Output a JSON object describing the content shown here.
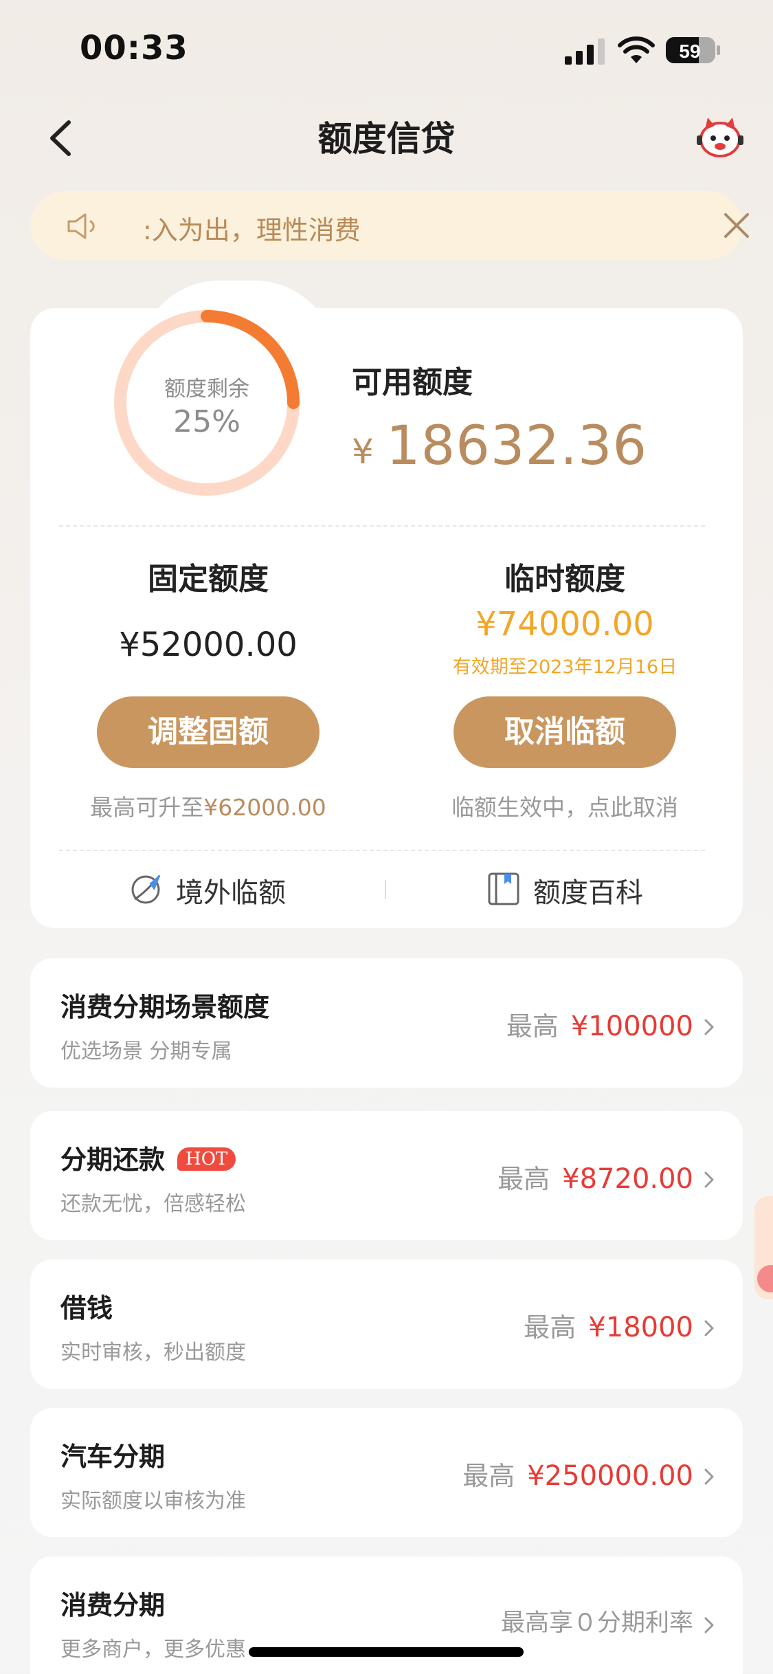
{
  "status_bar": {
    "time": "00:33",
    "battery": "59"
  },
  "nav": {
    "title": "额度信贷"
  },
  "notice": {
    "text": ":入为出，理性消费"
  },
  "summary": {
    "ring_label": "额度剩余",
    "ring_percent_text": "25%",
    "remaining_fraction": 0.25,
    "available_label": "可用额度",
    "currency_symbol": "¥",
    "available_amount": "18632.36"
  },
  "fixed": {
    "title": "固定额度",
    "amount": "¥52000.00",
    "button": "调整固额",
    "note_prefix": "最高可升至",
    "note_amount": "¥62000.00"
  },
  "temporary": {
    "title": "临时额度",
    "amount": "¥74000.00",
    "validity": "有效期至2023年12月16日",
    "button": "取消临额",
    "note": "临额生效中，点此取消"
  },
  "tools": [
    {
      "label": "境外临额",
      "icon": "plane-globe-icon"
    },
    {
      "label": "额度百科",
      "icon": "book-icon"
    }
  ],
  "products": [
    {
      "title": "消费分期场景额度",
      "subtitle": "优选场景 分期专属",
      "prefix": "最高",
      "amount": "¥100000"
    },
    {
      "title": "分期还款",
      "badge": "HOT",
      "subtitle": "还款无忧，倍感轻松",
      "prefix": "最高",
      "amount": "¥8720.00"
    },
    {
      "title": "借钱",
      "subtitle": "实时审核，秒出额度",
      "prefix": "最高",
      "amount": "¥18000"
    },
    {
      "title": "汽车分期",
      "subtitle": "实际额度以审核为准",
      "prefix": "最高",
      "amount": "¥250000.00"
    },
    {
      "title": "消费分期",
      "subtitle": "更多商户，更多优惠",
      "prefix": "最高享０分期利率",
      "amount": ""
    }
  ],
  "colors": {
    "accent_gold": "#c9965f",
    "amount_gold": "#b98c5f",
    "orange": "#f2a627",
    "red": "#e73b35",
    "ring": "#f47c32"
  }
}
